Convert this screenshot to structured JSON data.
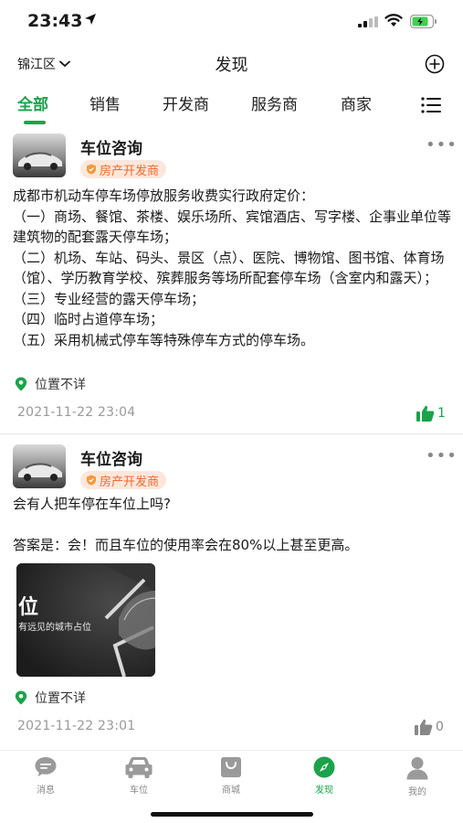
{
  "status_bar": {
    "time": "23:43"
  },
  "nav": {
    "district": "锦江区",
    "title": "发现"
  },
  "tabs": [
    {
      "label": "全部"
    },
    {
      "label": "销售"
    },
    {
      "label": "开发商"
    },
    {
      "label": "服务商"
    },
    {
      "label": "商家"
    }
  ],
  "posts": [
    {
      "author": "车位咨询",
      "badge": "房产开发商",
      "content": "成都市机动车停车场停放服务收费实行政府定价：\n（一）商场、餐馆、茶楼、娱乐场所、宾馆酒店、写字楼、企事业单位等建筑物的配套露天停车场；\n（二）机场、车站、码头、景区（点）、医院、博物馆、图书馆、体育场（馆）、学历教育学校、殡葬服务等场所配套停车场（含室内和露天）；\n（三）专业经营的露天停车场；\n（四）临时占道停车场；\n（五）采用机械式停车等特殊停车方式的停车场。",
      "location": "位置不详",
      "timestamp": "2021-11-22 23:04",
      "likes": "1",
      "liked": true
    },
    {
      "author": "车位咨询",
      "badge": "房产开发商",
      "content": "会有人把车停在车位上吗?\n\n答案是：会！而且车位的使用率会在80%以上甚至更高。",
      "image_text_big": "位",
      "image_text_small": "有远见的城市占位",
      "location": "位置不详",
      "timestamp": "2021-11-22 23:01",
      "likes": "0",
      "liked": false
    }
  ],
  "bottom_tabs": [
    {
      "label": "消息",
      "icon": "message-icon"
    },
    {
      "label": "车位",
      "icon": "car-icon"
    },
    {
      "label": "商城",
      "icon": "shopping-bag-icon"
    },
    {
      "label": "发现",
      "icon": "compass-icon",
      "active": true
    },
    {
      "label": "我的",
      "icon": "user-icon"
    }
  ],
  "colors": {
    "accent": "#1aa34a",
    "badge_bg": "#fde7dc",
    "badge_text": "#f06a2a",
    "muted": "#999999"
  }
}
